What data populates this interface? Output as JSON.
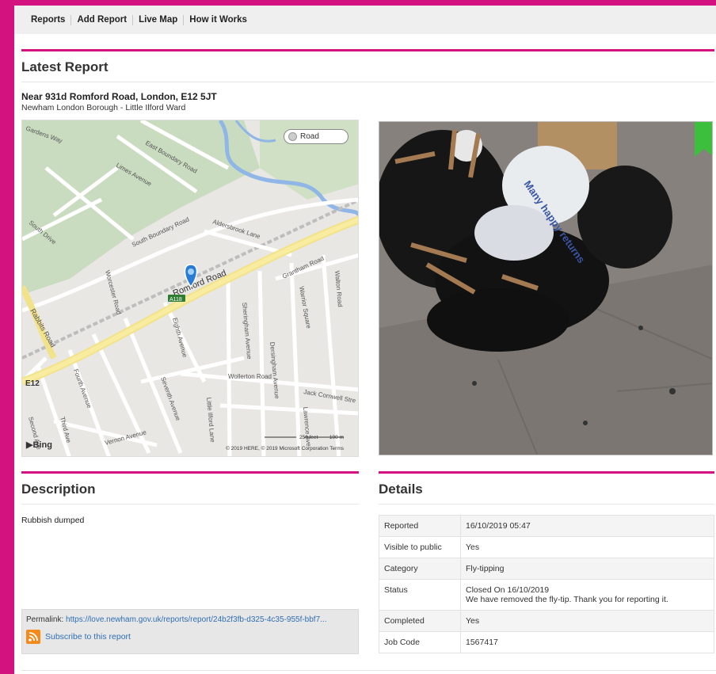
{
  "nav": {
    "items": [
      "Reports",
      "Add Report",
      "Live Map",
      "How it Works"
    ]
  },
  "page_title": "Latest Report",
  "location": {
    "address": "Near 931d Romford Road, London, E12 5JT",
    "ward": "Newham London Borough - Little Ilford Ward"
  },
  "map": {
    "road_toggle": "Road",
    "bing": "Bing",
    "scale_feet": "250 feet",
    "scale_m": "100 m",
    "copyright": "© 2019 HERE, © 2019 Microsoft Corporation  Terms",
    "labels": {
      "romford": "Romford Road",
      "a118": "A118",
      "e12": "E12",
      "south_boundary": "South Boundary Road",
      "east_boundary": "East Boundary Road",
      "aldersbrook": "Aldersbrook Lane",
      "grantham": "Grantham Road",
      "rabbits": "Rabbits Road",
      "worcester": "Worcester Road",
      "eighth": "Eighth Avenue",
      "sheringham": "Sheringham Avenue",
      "warrior": "Warrior Square",
      "walton": "Walton Road",
      "wollerton": "Wollerton Road",
      "jack": "Jack Cornwell Stre",
      "little_ilford": "Little Ilford Lane",
      "seventh": "Seventh Avenue",
      "fourth": "Fourth Avenue",
      "vernon": "Vernon Avenue",
      "third": "Third Ave",
      "gardens": "Gardens Way",
      "limes": "Limes Avenue",
      "south_drive": "South Drive",
      "desingham": "Dersingham Avenue",
      "lawrence": "Lawrence Ave",
      "second": "Second Ave"
    }
  },
  "photo": {
    "text": "Many happy returns"
  },
  "description": {
    "heading": "Description",
    "text": "Rubbish dumped"
  },
  "permalink": {
    "label": "Permalink: ",
    "url": "https://love.newham.gov.uk/reports/report/24b2f3fb-d325-4c35-955f-bbf7...",
    "subscribe": "Subscribe to this report"
  },
  "details": {
    "heading": "Details",
    "rows": [
      {
        "key": "Reported",
        "value": "16/10/2019 05:47"
      },
      {
        "key": "Visible to public",
        "value": "Yes"
      },
      {
        "key": "Category",
        "value": "Fly-tipping"
      },
      {
        "key": "Status",
        "value": "Closed On 16/10/2019",
        "value2": "We have removed the fly-tip. Thank you for reporting it."
      },
      {
        "key": "Completed",
        "value": "Yes"
      },
      {
        "key": "Job Code",
        "value": "1567417"
      }
    ]
  },
  "colors": {
    "accent": "#d4127f",
    "link": "#2f6fb3",
    "rss": "#f38a1a"
  }
}
